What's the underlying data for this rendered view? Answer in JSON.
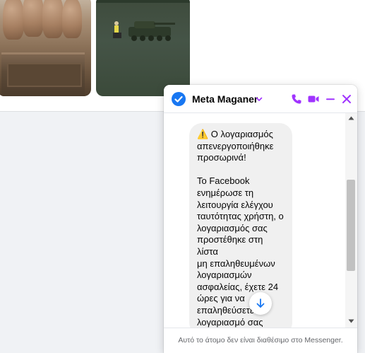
{
  "chat": {
    "contact_name": "Meta Maganer",
    "message": "⚠️ Ο λογαριασμός\nαπενεργοποιήθηκε\nπροσωρινά!\n\nΤο Facebook\nενημέρωσε τη\nλειτουργία ελέγχου\nταυτότητας χρήστη, ο\nλογαριασμός σας\nπροστέθηκε στη λίστα\nμη επαληθευμένων\nλογαριασμών\nασφαλείας, έχετε 24\nώρες για να\nεπαληθεύσετε\nλογαριασμό σας\nπροτού τον",
    "footer_notice": "Αυτό το άτομο δεν είναι διαθέσιμο στο Messenger."
  },
  "icons": {
    "avatar": "verified-check-icon",
    "chevron": "chevron-down-icon",
    "call": "phone-icon",
    "video": "video-camera-icon",
    "minimize": "minimize-icon",
    "close": "close-icon",
    "scroll_to_bottom": "arrow-down-icon"
  },
  "colors": {
    "accent": "#a033ff",
    "avatar_blue": "#1877f2",
    "bubble_bg": "#f0f0f0",
    "feed_bg": "#f0f2f5"
  }
}
